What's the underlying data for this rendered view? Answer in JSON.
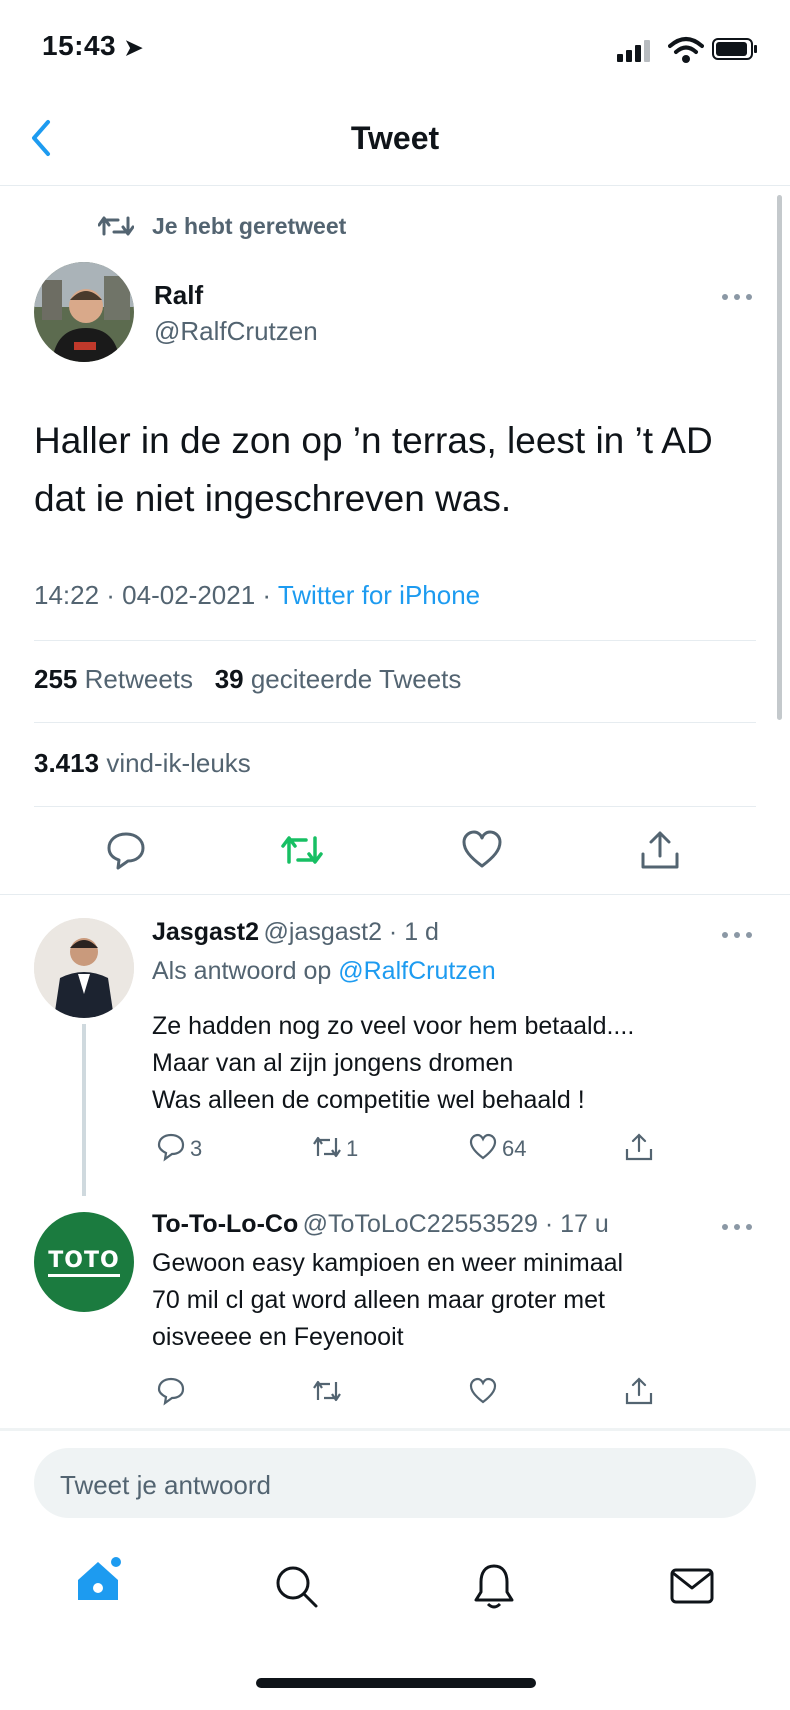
{
  "status_bar": {
    "time": "15:43"
  },
  "header": {
    "title": "Tweet"
  },
  "retweet_notice": "Je hebt geretweet",
  "main_tweet": {
    "name": "Ralf",
    "handle": "@RalfCrutzen",
    "text": "Haller in de zon op ’n terras, leest in ’t AD dat ie niet ingeschreven was.",
    "time": "14:22 · 04-02-2021 · ",
    "source": "Twitter for iPhone",
    "retweets_count": "255",
    "retweets_label": "Retweets",
    "quotes_count": "39",
    "quotes_label": "geciteerde Tweets",
    "likes_count": "3.413",
    "likes_label": "vind-ik-leuks"
  },
  "replies": [
    {
      "name": "Jasgast2",
      "handle_time": "@jasgast2 · 1 d",
      "reply_to_label": "Als antwoord op",
      "reply_to_handle": "@RalfCrutzen",
      "text_lines": [
        "Ze hadden nog zo veel voor hem betaald....",
        "Maar van al zijn jongens dromen",
        "Was alleen de competitie wel behaald !"
      ],
      "reply_count": "3",
      "retweet_count": "1",
      "like_count": "64"
    },
    {
      "name": "To-To-Lo-Co",
      "handle_time": "@ToToLoC22553529 · 17 u",
      "avatar_text": "TOTO",
      "text_lines": [
        "Gewoon easy kampioen en weer minimaal",
        "70 mil cl gat word alleen maar groter met",
        "oisveeee en Feyenooit"
      ]
    }
  ],
  "compose": {
    "placeholder": "Tweet je antwoord"
  },
  "colors": {
    "accent": "#1d9bf0",
    "retweet_green": "#17bf63",
    "muted": "#536471"
  },
  "tab_bar": [
    "home-icon",
    "search-icon",
    "bell-icon",
    "mail-icon"
  ]
}
